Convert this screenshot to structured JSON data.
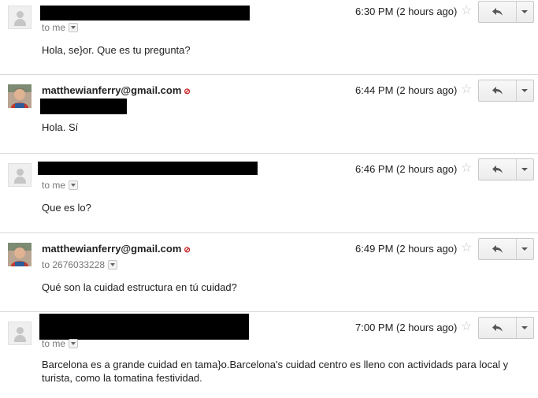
{
  "messages": [
    {
      "sender": "",
      "recipient_label": "to me",
      "time": "6:30 PM (2 hours ago)",
      "body": "Hola, se}or. Que es tu pregunta?"
    },
    {
      "sender": "matthewianferry@gmail.com",
      "recipient_label": "",
      "time": "6:44 PM (2 hours ago)",
      "body": "Hola. Sí"
    },
    {
      "sender": "",
      "recipient_label": "to me",
      "time": "6:46 PM (2 hours ago)",
      "body": "Que es lo?"
    },
    {
      "sender": "matthewianferry@gmail.com",
      "recipient_label": "to 2676033228",
      "time": "6:49 PM (2 hours ago)",
      "body": "Qué son la cuidad estructura en tú cuidad?"
    },
    {
      "sender": "",
      "recipient_label": "to me",
      "time": "7:00 PM (2 hours ago)",
      "body": "Barcelona es a grande cuidad en tama}o.Barcelona's cuidad centro es lleno con actividads para local y turista, como la tomatina festividad."
    }
  ],
  "icons": {
    "star": "star-outline-icon",
    "reply": "reply-arrow-icon",
    "more": "dropdown-arrow-icon",
    "presence": "chat-status-icon",
    "avatar_default": "default-person-icon"
  },
  "colors": {
    "presence": "#c41e1e",
    "redaction": "#000000",
    "divider": "#d8d8d8"
  }
}
